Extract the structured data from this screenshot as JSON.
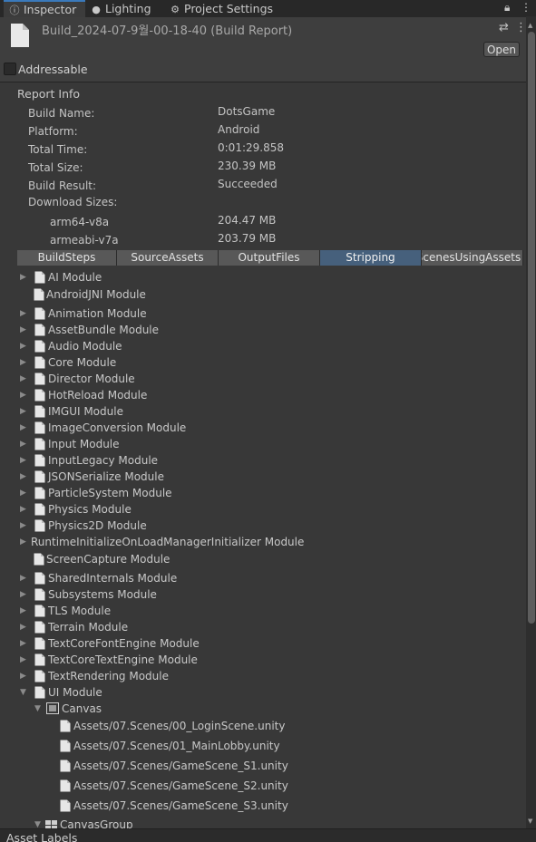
{
  "window_tabs": [
    {
      "label": "Inspector",
      "icon": "info-icon"
    },
    {
      "label": "Lighting",
      "icon": "bulb-icon"
    },
    {
      "label": "Project Settings",
      "icon": "gear-icon"
    }
  ],
  "header": {
    "title": "Build_2024-07-9월-00-18-40 (Build Report)",
    "open_label": "Open"
  },
  "addressable": {
    "label": "Addressable",
    "checked": false
  },
  "report_info": {
    "title": "Report Info",
    "rows": [
      {
        "label": "Build Name:",
        "value": "DotsGame"
      },
      {
        "label": "Platform:",
        "value": "Android"
      },
      {
        "label": "Total Time:",
        "value": "0:01:29.858"
      },
      {
        "label": "Total Size:",
        "value": "230.39 MB"
      },
      {
        "label": "Build Result:",
        "value": "Succeeded"
      },
      {
        "label": "Download Sizes:",
        "value": ""
      }
    ],
    "download_sizes": [
      {
        "label": "arm64-v8a",
        "value": "204.47 MB"
      },
      {
        "label": "armeabi-v7a",
        "value": "203.79 MB"
      }
    ]
  },
  "report_tabs": {
    "items": [
      "BuildSteps",
      "SourceAssets",
      "OutputFiles",
      "Stripping",
      "ScenesUsingAssets"
    ],
    "selected": "Stripping"
  },
  "modules": [
    "AI Module",
    "AndroidJNI Module",
    "Animation Module",
    "AssetBundle Module",
    "Audio Module",
    "Core Module",
    "Director Module",
    "HotReload Module",
    "IMGUI Module",
    "ImageConversion Module",
    "Input Module",
    "InputLegacy Module",
    "JSONSerialize Module",
    "ParticleSystem Module",
    "Physics Module",
    "Physics2D Module",
    "RuntimeInitializeOnLoadManagerInitializer Module",
    "ScreenCapture Module",
    "SharedInternals Module",
    "Subsystems Module",
    "TLS Module",
    "Terrain Module",
    "TextCoreFontEngine Module",
    "TextCoreTextEngine Module",
    "TextRendering Module",
    "UI Module"
  ],
  "ui_module": {
    "canvas": {
      "label": "Canvas",
      "scenes": [
        "Assets/07.Scenes/00_LoginScene.unity",
        "Assets/07.Scenes/01_MainLobby.unity",
        "Assets/07.Scenes/GameScene_S1.unity",
        "Assets/07.Scenes/GameScene_S2.unity",
        "Assets/07.Scenes/GameScene_S3.unity"
      ]
    },
    "canvas_group": {
      "label": "CanvasGroup"
    }
  },
  "footer": {
    "label": "Asset Labels"
  },
  "colors": {
    "accent": "#3a79bb",
    "selected_tab": "#46607c",
    "background": "#383838"
  }
}
